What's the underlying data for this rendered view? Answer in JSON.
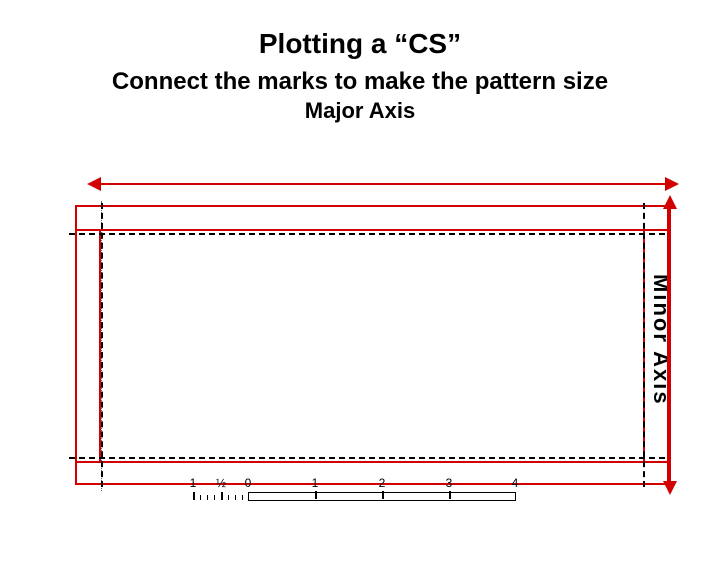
{
  "title": "Plotting a “CS”",
  "subtitle": "Connect the marks to make the pattern size",
  "axes": {
    "major": "Major Axis",
    "minor": "Minor Axis"
  },
  "ruler": {
    "left_labels": [
      "1",
      "½",
      "0"
    ],
    "right_labels": [
      "1",
      "2",
      "3",
      "4"
    ]
  }
}
